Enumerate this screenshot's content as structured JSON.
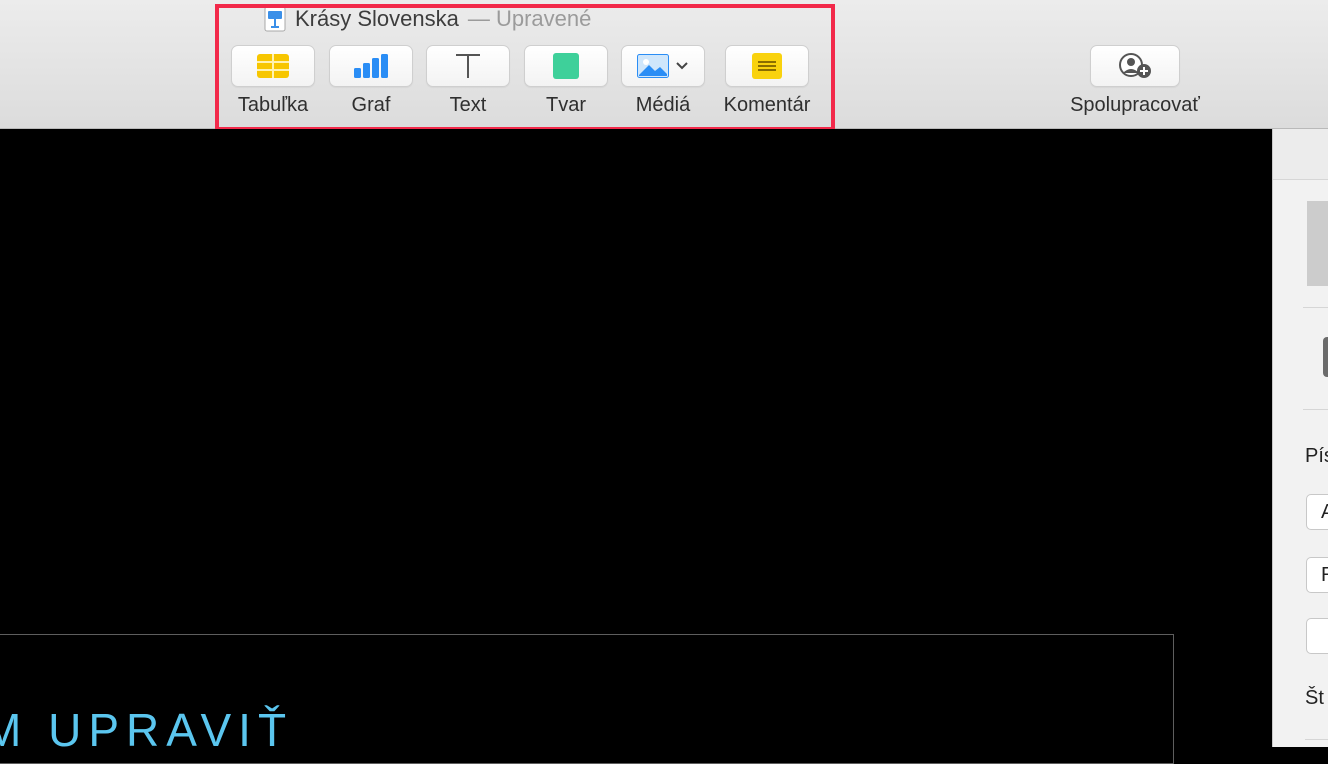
{
  "window": {
    "title": "Krásy Slovenska",
    "status": "— Upravené"
  },
  "toolbar": {
    "items": [
      {
        "label": "Tabuľka",
        "icon": "table-icon"
      },
      {
        "label": "Graf",
        "icon": "chart-icon"
      },
      {
        "label": "Text",
        "icon": "text-icon"
      },
      {
        "label": "Tvar",
        "icon": "shape-icon"
      },
      {
        "label": "Médiá",
        "icon": "media-icon"
      },
      {
        "label": "Komentár",
        "icon": "comment-icon"
      }
    ],
    "collaborate": {
      "label": "Spolupracovať",
      "icon": "collaborate-icon"
    }
  },
  "slide": {
    "text": "M UPRAVIŤ",
    "text_color": "#5bc6ef"
  },
  "sidebar": {
    "section_label": "Pís",
    "field_1": "A",
    "field_2": "R",
    "field_3": "",
    "bottom_label": "Št"
  },
  "colors": {
    "highlight": "#f2294a",
    "table_icon": "#f7c600",
    "chart_icon": "#2a8df5",
    "shape_icon": "#3ed09a",
    "comment_icon": "#f9d20e"
  }
}
